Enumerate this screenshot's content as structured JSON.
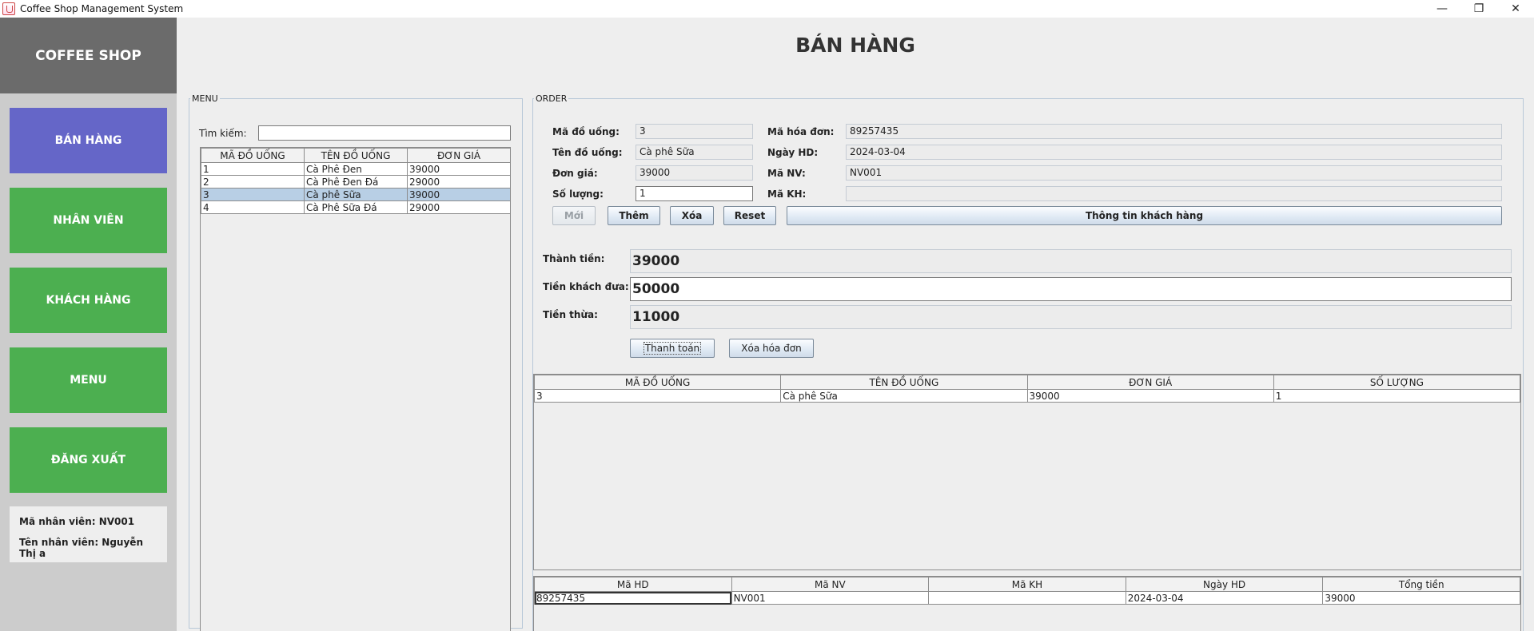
{
  "window": {
    "title": "Coffee Shop Management System",
    "min": "—",
    "restore": "❐",
    "close": "✕"
  },
  "sidebar": {
    "brand": "COFFEE SHOP",
    "items": [
      {
        "label": "BÁN HÀNG",
        "active": true
      },
      {
        "label": "NHÂN VIÊN"
      },
      {
        "label": "KHÁCH HÀNG"
      },
      {
        "label": "MENU"
      },
      {
        "label": "ĐĂNG XUẤT"
      }
    ],
    "employee": {
      "id_text": "Mã nhân viên: NV001",
      "name_text": "Tên nhân viên: Nguyễn Thị a"
    }
  },
  "page_title": "BÁN HÀNG",
  "menu": {
    "legend": "MENU",
    "search_label": "Tìm kiếm:",
    "search_value": "",
    "columns": [
      "MÃ ĐỒ UỐNG",
      "TÊN ĐỒ UỐNG",
      "ĐƠN GIÁ"
    ],
    "rows": [
      [
        "1",
        "Cà Phê Đen",
        "39000"
      ],
      [
        "2",
        "Cà Phê Đen Đá",
        "29000"
      ],
      [
        "3",
        "Cà phê Sữa",
        "39000"
      ],
      [
        "4",
        "Cà Phê Sữa Đá",
        "29000"
      ]
    ],
    "selected_row": 2
  },
  "order": {
    "legend": "ORDER",
    "fields": {
      "ma_do_uong_label": "Mã đồ uống:",
      "ma_do_uong": "3",
      "ten_do_uong_label": "Tên đồ uống:",
      "ten_do_uong": "Cà phê Sữa",
      "don_gia_label": "Đơn giá:",
      "don_gia": "39000",
      "so_luong_label": "Số lượng:",
      "so_luong": "1",
      "ma_hoa_don_label": "Mã hóa đơn:",
      "ma_hoa_don": "89257435",
      "ngay_hd_label": "Ngày HD:",
      "ngay_hd": "2024-03-04",
      "ma_nv_label": "Mã NV:",
      "ma_nv": "NV001",
      "ma_kh_label": "Mã KH:",
      "ma_kh": ""
    },
    "buttons": {
      "moi": "Mới",
      "them": "Thêm",
      "xoa": "Xóa",
      "reset": "Reset",
      "thong_tin_kh": "Thông tin khách hàng"
    },
    "payment": {
      "thanh_tien_label": "Thành tiền:",
      "thanh_tien": "39000",
      "tien_khach_dua_label": "Tiền khách đưa:",
      "tien_khach_dua": "50000",
      "tien_thua_label": "Tiền thừa:",
      "tien_thua": "11000",
      "thanh_toan": "Thanh toán",
      "xoa_hoa_don": "Xóa hóa đơn"
    },
    "detail_table": {
      "columns": [
        "MÃ ĐỒ UỐNG",
        "TÊN ĐỒ UỐNG",
        "ĐƠN GIÁ",
        "SỐ LƯỢNG"
      ],
      "rows": [
        [
          "3",
          "Cà phê Sữa",
          "39000",
          "1"
        ]
      ]
    },
    "invoice_table": {
      "columns": [
        "Mã HD",
        "Mã NV",
        "Mã KH",
        "Ngày HD",
        "Tổng tiền"
      ],
      "rows": [
        [
          "89257435",
          "NV001",
          "",
          "2024-03-04",
          "39000"
        ]
      ]
    }
  }
}
